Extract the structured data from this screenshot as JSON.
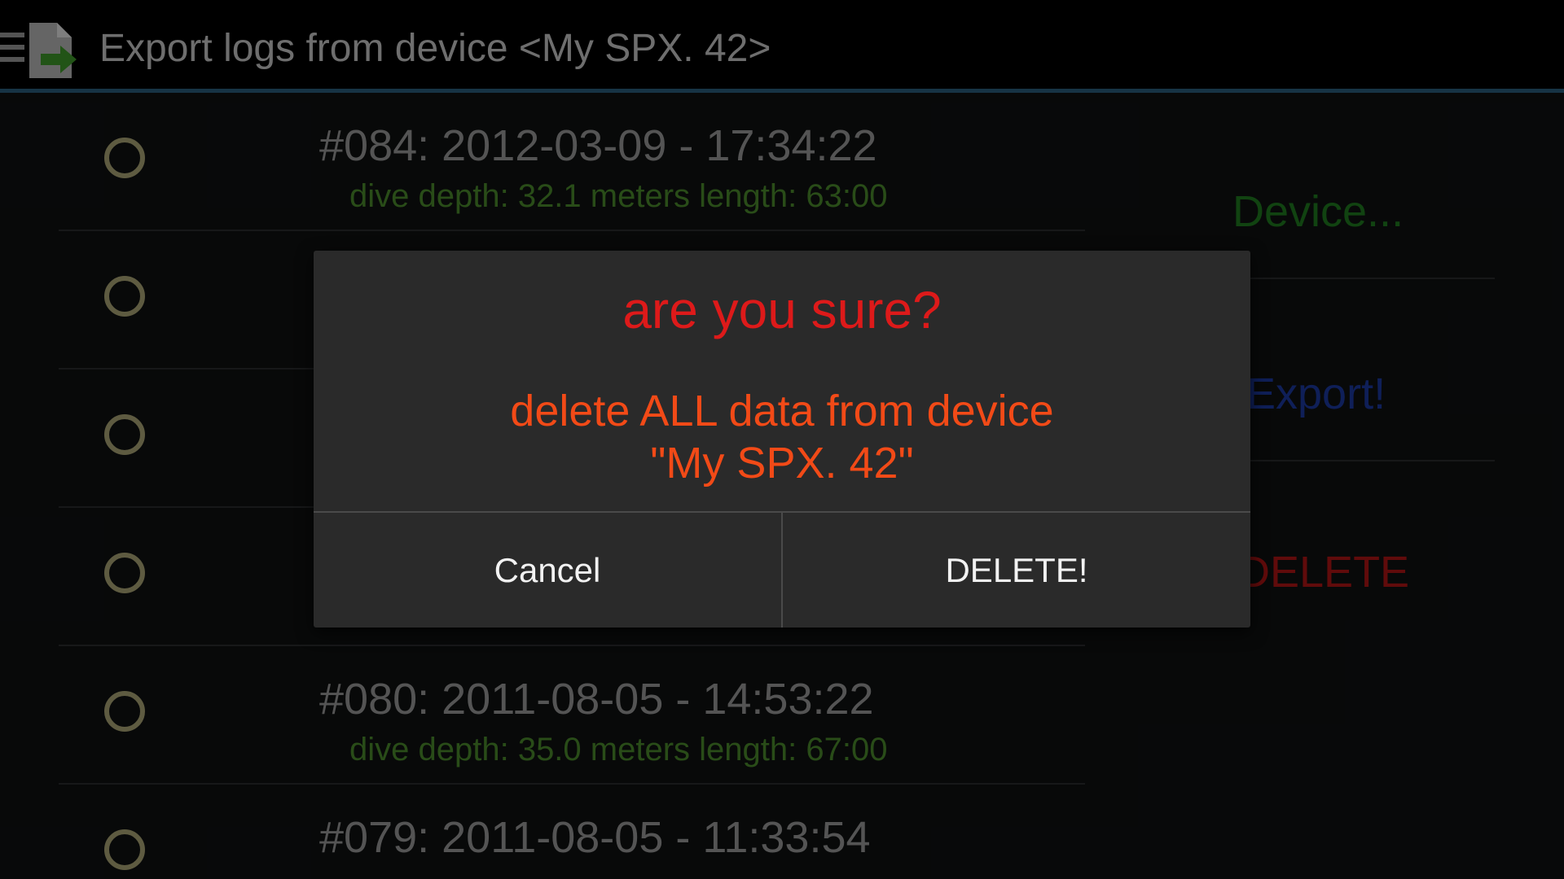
{
  "header": {
    "title": "Export logs from device <My SPX. 42>"
  },
  "logs": [
    {
      "title": "#084: 2012-03-09 - 17:34:22",
      "details": "dive depth: 32.1 meters length: 63:00"
    },
    {
      "title": "",
      "details": ""
    },
    {
      "title": "",
      "details": ""
    },
    {
      "title": "",
      "details": ""
    },
    {
      "title": "#080: 2011-08-05 - 14:53:22",
      "details": "dive depth: 35.0 meters length: 67:00"
    },
    {
      "title": "#079: 2011-08-05 - 11:33:54",
      "details": ""
    }
  ],
  "side_actions": {
    "device": "Device...",
    "export": "Export!",
    "delete": "DELETE"
  },
  "dialog": {
    "title": "are you sure?",
    "message_line1": "delete ALL data from device",
    "message_line2": "\"My SPX. 42\"",
    "cancel": "Cancel",
    "confirm": "DELETE!"
  },
  "colors": {
    "accent_bar": "#2b5f7f",
    "radio": "#aba677",
    "details_text": "#4b8a2d",
    "device_action": "#1f7a1f",
    "export_action": "#1c3aa0",
    "delete_action": "#b01515",
    "dialog_title": "#dd1a1a",
    "dialog_message": "#f24a17"
  }
}
